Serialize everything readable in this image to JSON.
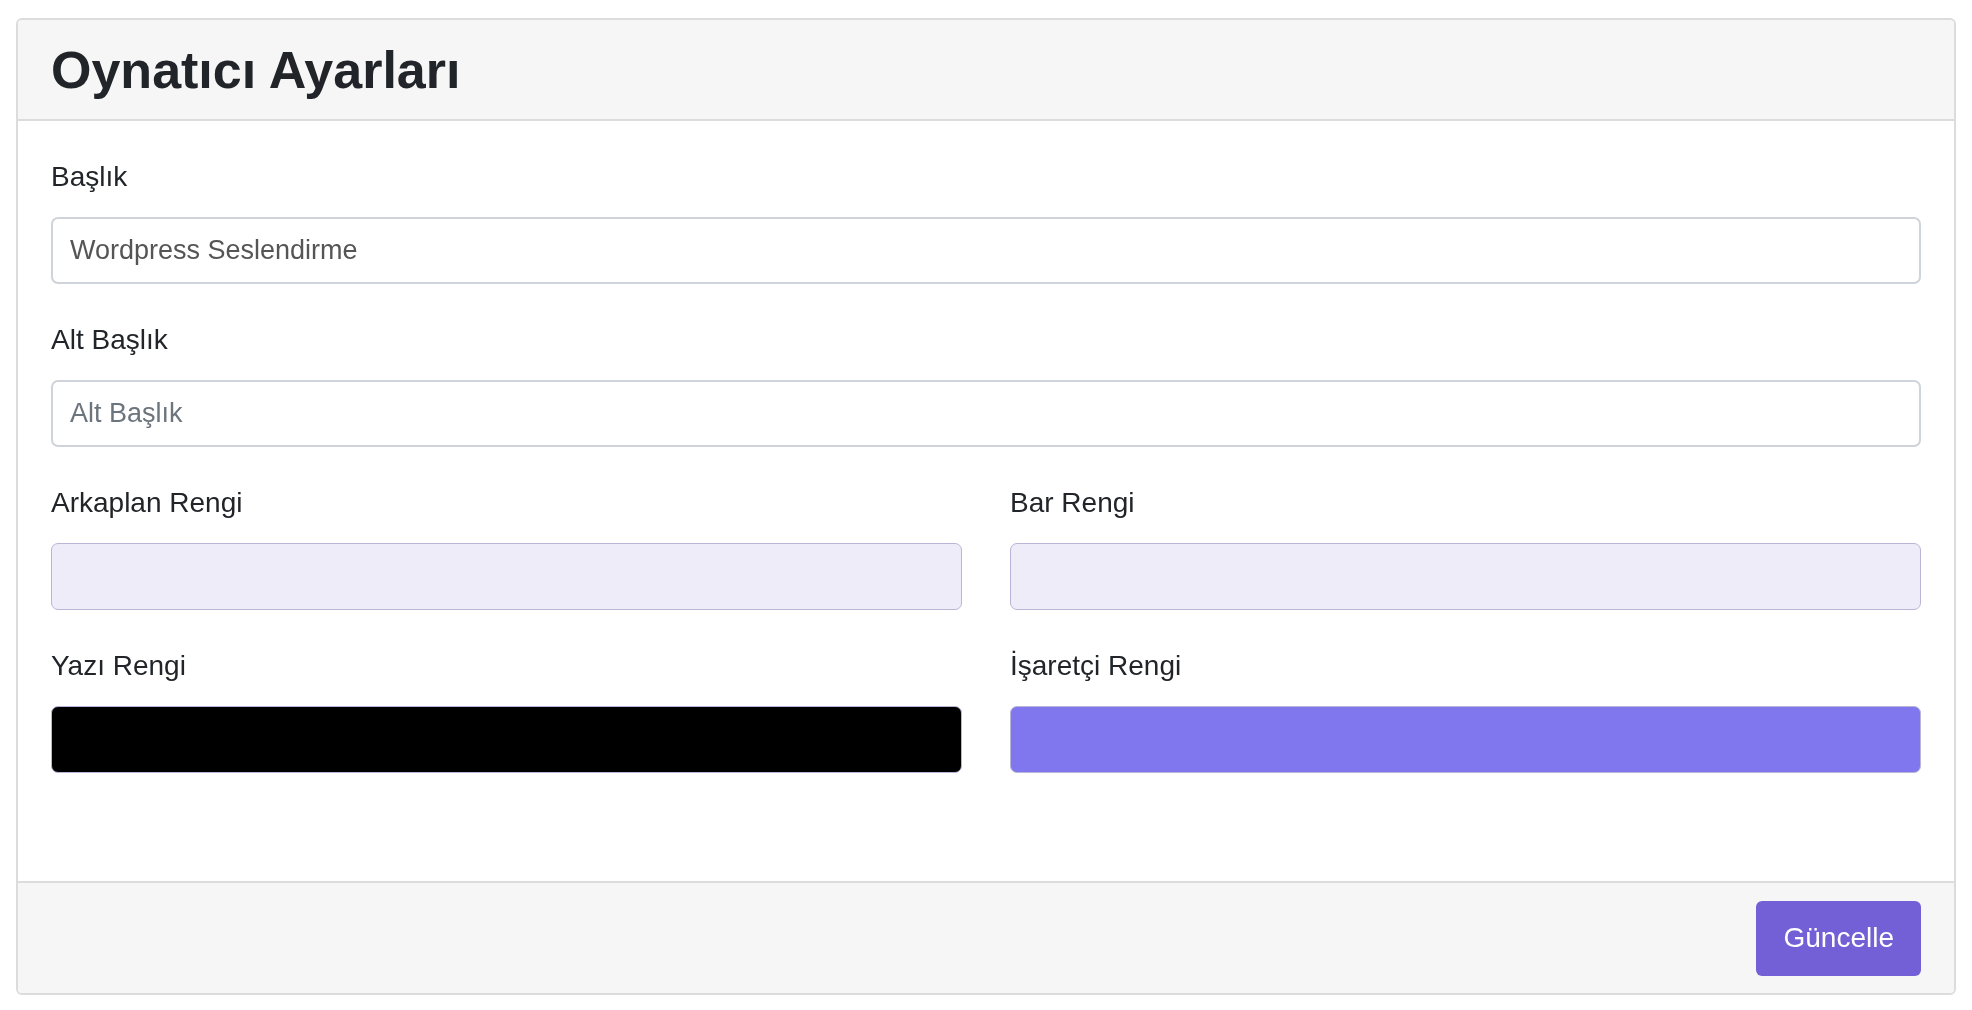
{
  "card": {
    "title": "Oynatıcı Ayarları"
  },
  "fields": [
    {
      "kind": "text",
      "label": "Başlık",
      "value": "Wordpress Seslendirme",
      "wide": true
    },
    {
      "kind": "text",
      "label": "Alt Başlık",
      "placeholder": "Alt Başlık",
      "wide": true
    },
    {
      "kind": "color",
      "label": "Arkaplan Rengi",
      "color": "#eeecf9",
      "wide": false
    },
    {
      "kind": "color",
      "label": "Bar Rengi",
      "color": "#eeecf9",
      "wide": false
    },
    {
      "kind": "color",
      "label": "Yazı Rengi",
      "color": "#000000",
      "wide": false
    },
    {
      "kind": "color",
      "label": "İşaretçi Rengi",
      "color": "#8077ee",
      "wide": false
    }
  ],
  "footer": {
    "button": "Güncelle"
  }
}
